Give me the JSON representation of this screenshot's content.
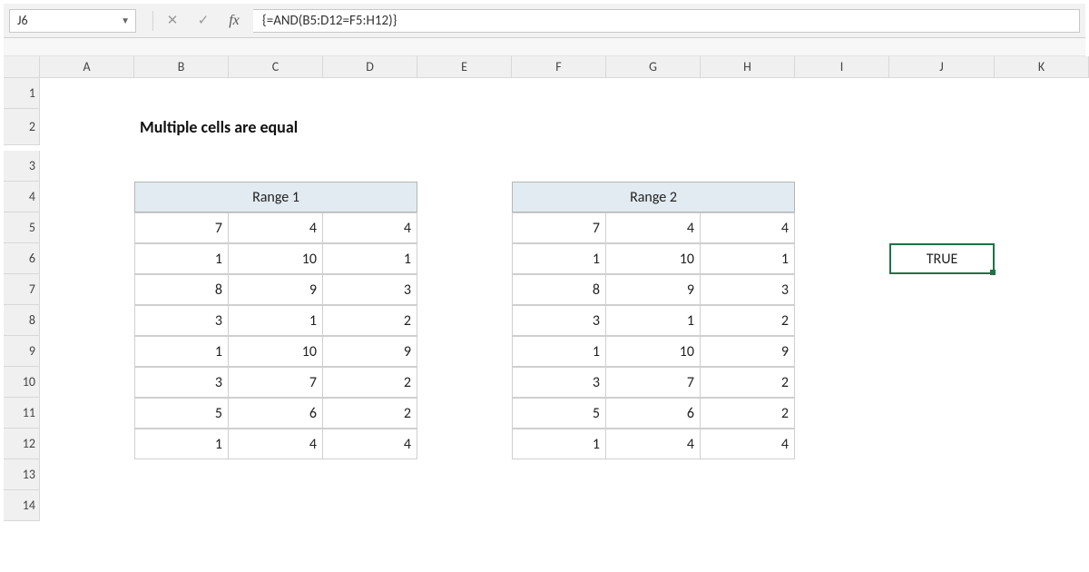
{
  "formula_bar": {
    "cell_ref": "J6",
    "formula": "{=AND(B5:D12=F5:H12)}",
    "fx_label": "fx"
  },
  "title": "Multiple cells are equal",
  "columns": [
    "A",
    "B",
    "C",
    "D",
    "E",
    "F",
    "G",
    "H",
    "I",
    "J",
    "K"
  ],
  "rows": [
    "1",
    "2",
    "3",
    "4",
    "5",
    "6",
    "7",
    "8",
    "9",
    "10",
    "11",
    "12",
    "13",
    "14"
  ],
  "range1": {
    "header": "Range 1",
    "data": [
      [
        7,
        4,
        4
      ],
      [
        1,
        10,
        1
      ],
      [
        8,
        9,
        3
      ],
      [
        3,
        1,
        2
      ],
      [
        1,
        10,
        9
      ],
      [
        3,
        7,
        2
      ],
      [
        5,
        6,
        2
      ],
      [
        1,
        4,
        4
      ]
    ]
  },
  "range2": {
    "header": "Range 2",
    "data": [
      [
        7,
        4,
        4
      ],
      [
        1,
        10,
        1
      ],
      [
        8,
        9,
        3
      ],
      [
        3,
        1,
        2
      ],
      [
        1,
        10,
        9
      ],
      [
        3,
        7,
        2
      ],
      [
        5,
        6,
        2
      ],
      [
        1,
        4,
        4
      ]
    ]
  },
  "result": {
    "value": "TRUE"
  },
  "chart_data": {
    "type": "table",
    "title": "Multiple cells are equal",
    "ranges": {
      "Range 1": [
        [
          7,
          4,
          4
        ],
        [
          1,
          10,
          1
        ],
        [
          8,
          9,
          3
        ],
        [
          3,
          1,
          2
        ],
        [
          1,
          10,
          9
        ],
        [
          3,
          7,
          2
        ],
        [
          5,
          6,
          2
        ],
        [
          1,
          4,
          4
        ]
      ],
      "Range 2": [
        [
          7,
          4,
          4
        ],
        [
          1,
          10,
          1
        ],
        [
          8,
          9,
          3
        ],
        [
          3,
          1,
          2
        ],
        [
          1,
          10,
          9
        ],
        [
          3,
          7,
          2
        ],
        [
          5,
          6,
          2
        ],
        [
          1,
          4,
          4
        ]
      ]
    },
    "formula": "{=AND(B5:D12=F5:H12)}",
    "result": "TRUE"
  }
}
